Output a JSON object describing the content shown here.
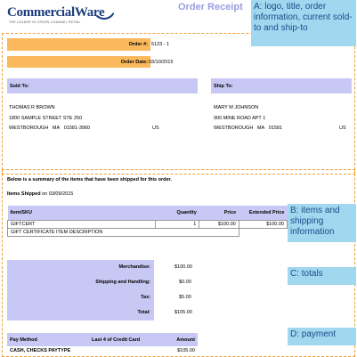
{
  "logo": {
    "name": "CommercialWare",
    "tagline": "THE LEADER IN CROSS-CHANNEL RETAIL"
  },
  "page_title": "Order Receipt",
  "order": {
    "number_label": "Order #:",
    "number": "5123 - 1",
    "date_label": "Order Date:",
    "date": "03/10/2015"
  },
  "sold_to": {
    "label": "Sold To:",
    "name": "THOMAS R BROWN",
    "street": "1800 SAMPLE STREET  STE 250",
    "city": "WESTBOROUGH",
    "state": "MA",
    "zip": "01581-3960",
    "country": "US"
  },
  "ship_to": {
    "label": "Ship To:",
    "name": "MARY M JOHNSON",
    "street": "900 MINE ROAD  APT 1",
    "city": "WESTBOROUGH",
    "state": "MA",
    "zip": "01581",
    "country": "US"
  },
  "summary_note": "Below is a summary of the items that have been shipped for this order.",
  "shipped": {
    "label": "Items Shipped",
    "on": "on",
    "date": "03/09/2015"
  },
  "items": {
    "headers": [
      "Item/SKU",
      "Quantity",
      "Price",
      "Extended Price"
    ],
    "rows": [
      {
        "sku": "GIFTCERT",
        "qty": "1",
        "price": "$100.00",
        "ext": "$100.00",
        "desc": "GIFT CERTIFICATE ITEM DESCRIPTION"
      }
    ]
  },
  "totals": {
    "merchandise_label": "Merchandise:",
    "merchandise": "$100.00",
    "shipping_label": "Shipping and Handling:",
    "shipping": "$0.00",
    "tax_label": "Tax:",
    "tax": "$5.00",
    "total_label": "Total:",
    "total": "$105.00"
  },
  "payment": {
    "headers": [
      "Pay Method",
      "Last 4 of Credit Card",
      "Amount"
    ],
    "rows": [
      {
        "method": "CASH, CHECKS PAYTYPE",
        "last4": "",
        "amount": "$105.00"
      }
    ]
  },
  "annotations": {
    "a": "A: logo, title, order information, current sold-to and ship-to",
    "b": "B: items and shipping information",
    "c": "C: totals",
    "d": "D: payment"
  }
}
